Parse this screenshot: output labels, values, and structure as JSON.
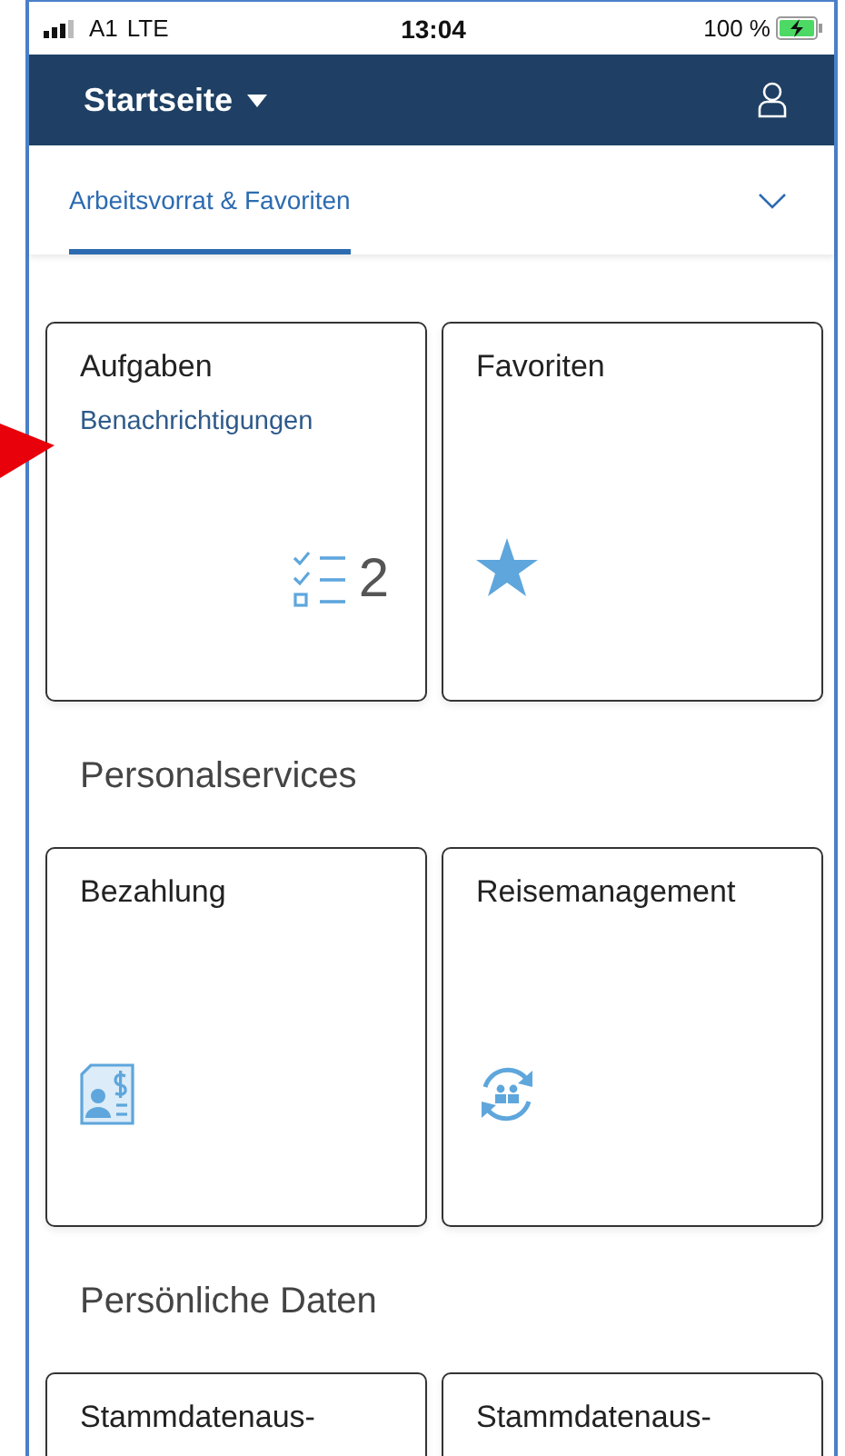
{
  "status_bar": {
    "carrier": "A1",
    "network": "LTE",
    "time": "13:04",
    "battery": "100 %"
  },
  "header": {
    "title": "Startseite"
  },
  "tabs": [
    {
      "label": "Arbeitsvorrat & Favoriten",
      "selected": true
    }
  ],
  "groups": [
    {
      "tiles": [
        {
          "title": "Aufgaben",
          "subtitle": "Benachrichtigungen",
          "kind": "tasks",
          "count": "2"
        },
        {
          "title": "Favoriten",
          "kind": "favorites"
        }
      ]
    },
    {
      "heading": "Personalservices",
      "tiles": [
        {
          "title": "Bezahlung",
          "kind": "payment"
        },
        {
          "title": "Reisemanagement",
          "kind": "travel"
        }
      ]
    },
    {
      "heading": "Persönliche Daten",
      "tiles": [
        {
          "title": "Stammdatenaus-",
          "kind": "plain"
        },
        {
          "title": "Stammdatenaus-",
          "kind": "plain"
        }
      ]
    }
  ]
}
